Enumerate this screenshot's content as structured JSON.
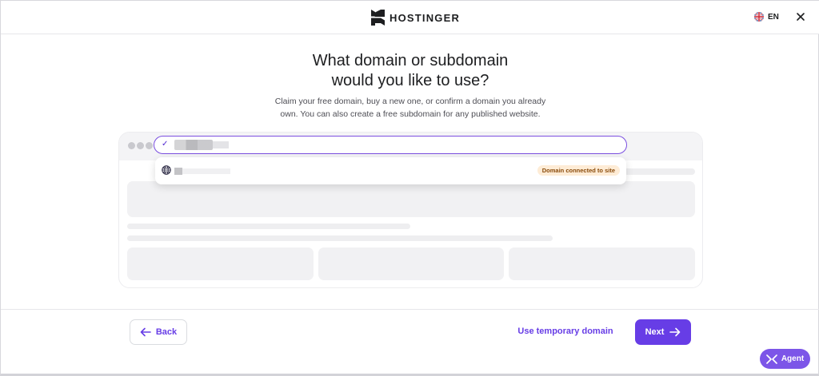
{
  "header": {
    "brand": "HOSTINGER",
    "language": "EN"
  },
  "main": {
    "title_line1": "What domain or subdomain",
    "title_line2": "would you like to use?",
    "subtitle_line1": "Claim your free domain, buy a new one, or confirm a domain you already",
    "subtitle_line2": "own. You can also create a free subdomain for any published website."
  },
  "dropdown": {
    "badge": "Domain connected to site"
  },
  "footer": {
    "back_label": "Back",
    "temp_domain_label": "Use temporary domain",
    "next_label": "Next"
  },
  "agent": {
    "label": "Agent"
  },
  "colors": {
    "accent": "#673de6",
    "badge_bg": "#feecd6",
    "badge_text": "#8a4b0b"
  }
}
